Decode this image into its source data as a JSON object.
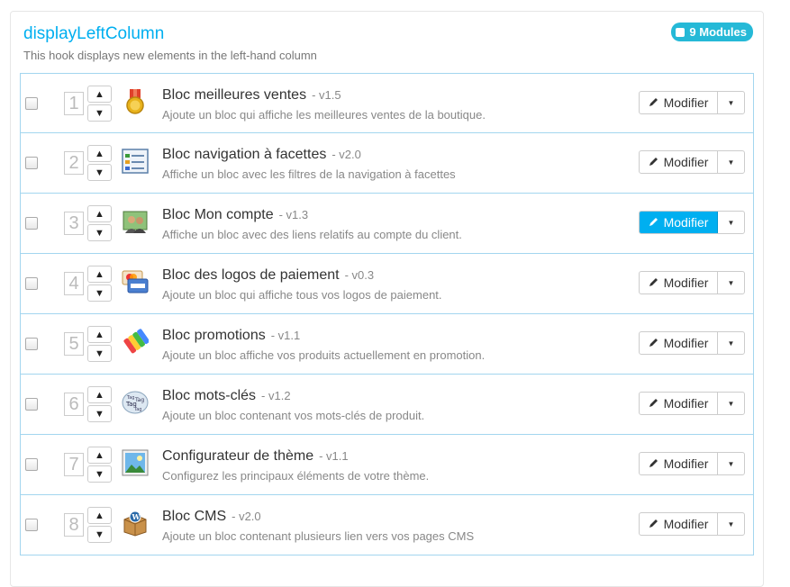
{
  "hook": {
    "title": "displayLeftColumn",
    "description": "This hook displays new elements in the left-hand column",
    "badge": "9 Modules"
  },
  "modules": [
    {
      "position": "1",
      "name": "Bloc meilleures ventes",
      "version": "- v1.5",
      "description": "Ajoute un bloc qui affiche les meilleures ventes de la boutique.",
      "icon": "medal-icon",
      "button": "Modifier",
      "active": false
    },
    {
      "position": "2",
      "name": "Bloc navigation à facettes",
      "version": "- v2.0",
      "description": "Affiche un bloc avec les filtres de la navigation à facettes",
      "icon": "facets-icon",
      "button": "Modifier",
      "active": false
    },
    {
      "position": "3",
      "name": "Bloc Mon compte",
      "version": "- v1.3",
      "description": "Affiche un bloc avec des liens relatifs au compte du client.",
      "icon": "account-icon",
      "button": "Modifier",
      "active": true
    },
    {
      "position": "4",
      "name": "Bloc des logos de paiement",
      "version": "- v0.3",
      "description": "Ajoute un bloc qui affiche tous vos logos de paiement.",
      "icon": "payment-cards-icon",
      "button": "Modifier",
      "active": false
    },
    {
      "position": "5",
      "name": "Bloc promotions",
      "version": "- v1.1",
      "description": "Ajoute un bloc affiche vos produits actuellement en promotion.",
      "icon": "promo-tags-icon",
      "button": "Modifier",
      "active": false
    },
    {
      "position": "6",
      "name": "Bloc mots-clés",
      "version": "- v1.2",
      "description": "Ajoute un bloc contenant vos mots-clés de produit.",
      "icon": "tag-cloud-icon",
      "button": "Modifier",
      "active": false
    },
    {
      "position": "7",
      "name": "Configurateur de thème",
      "version": "- v1.1",
      "description": "Configurez les principaux éléments de votre thème.",
      "icon": "theme-picture-icon",
      "button": "Modifier",
      "active": false
    },
    {
      "position": "8",
      "name": "Bloc CMS",
      "version": "- v2.0",
      "description": "Ajoute un bloc contenant plusieurs lien vers vos pages CMS",
      "icon": "cms-box-icon",
      "button": "Modifier",
      "active": false
    }
  ]
}
